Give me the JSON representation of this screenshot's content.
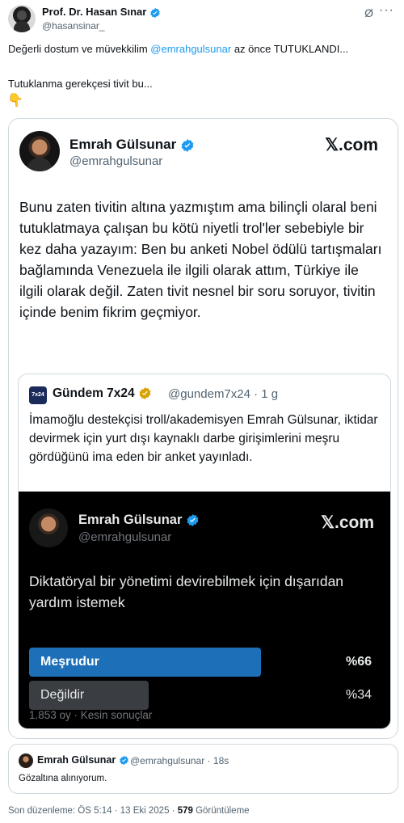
{
  "tweet": {
    "author_name": "Prof. Dr. Hasan Sınar",
    "author_handle": "@hasansinar_",
    "text_before_mention": "Değerli dostum ve müvekkilim ",
    "mention": "@emrahgulsunar",
    "text_after_mention": " az önce TUTUKLANDI...",
    "line2": "Tutuklanma gerekçesi tivit bu...",
    "emoji": "👇",
    "no_edit_icon": "Ø",
    "more_icon": "···"
  },
  "card": {
    "name": "Emrah Gülsunar",
    "handle": "@emrahgulsunar",
    "brand": "𝕏.com",
    "text": "Bunu zaten tivitin altına yazmıştım ama bilinçli olaral beni tutuklatmaya çalışan bu kötü niyetli trol'ler sebebiyle bir kez daha yazayım: Ben bu anketi Nobel ödülü tartışmaları bağlamında Venezuela ile ilgili olarak attım, Türkiye ile ilgili olarak değil. Zaten tivit nesnel bir soru soruyor, tivitin içinde benim fikrim geçmiyor."
  },
  "quote": {
    "avatar_text": "7x24",
    "name": "Gündem 7x24",
    "meta": "@gundem7x24 · 1 g",
    "text": "İmamoğlu destekçisi troll/akademisyen Emrah Gülsunar, iktidar devirmek için yurt dışı kaynaklı darbe girişimlerini meşru gördüğünü ima eden bir anket yayınladı."
  },
  "poll_image": {
    "name": "Emrah Gülsunar",
    "handle": "@emrahgulsunar",
    "brand": "𝕏.com",
    "question": "Diktatöryal bir yönetimi devirebilmek için dışarıdan yardım istemek",
    "options": [
      {
        "label": "Meşrudur",
        "percent": "%66",
        "value": 66,
        "color": "#1d6fb8"
      },
      {
        "label": "Değildir",
        "percent": "%34",
        "value": 34,
        "color": "#3a3d41"
      }
    ],
    "footer": "1.853 oy · Kesin sonuçlar"
  },
  "reply": {
    "name": "Emrah Gülsunar",
    "meta": "@emrahgulsunar · 18s",
    "text": "Gözaltına alınıyorum."
  },
  "footer": {
    "prefix": "Son düzenleme: ÖS 5:14 · 13 Eki 2025 · ",
    "views": "579",
    "views_label": " Görüntüleme"
  },
  "colors": {
    "accent": "#1d9bf0",
    "verified_blue": "#1d9bf0",
    "verified_gold": "#d8a200"
  }
}
